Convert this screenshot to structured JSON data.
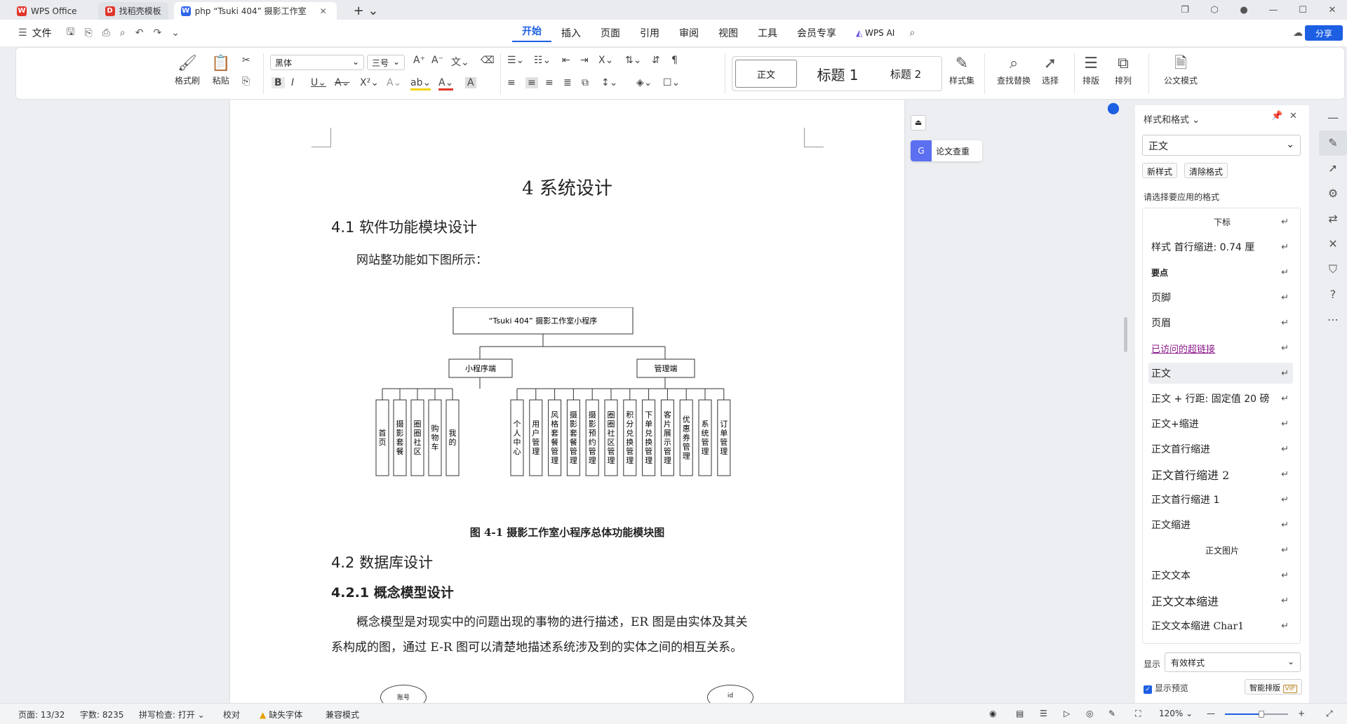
{
  "tabs": [
    {
      "label": "WPS Office"
    },
    {
      "label": "找稻壳模板"
    },
    {
      "label": "php “Tsuki 404” 摄影工作室"
    }
  ],
  "menu": {
    "file": "文件",
    "items": [
      "开始",
      "插入",
      "页面",
      "引用",
      "审阅",
      "视图",
      "工具",
      "会员专享"
    ],
    "active": "开始",
    "wps_ai": "WPS AI",
    "share": "分享"
  },
  "ribbon": {
    "format_painter": "格式刷",
    "paste": "粘贴",
    "font_name": "黑体",
    "font_size": "三号",
    "style_normal": "正文",
    "style_h1": "标题 1",
    "style_h2": "标题 2",
    "style_set": "样式集",
    "find_replace": "查找替换",
    "select": "选择",
    "layout": "排版",
    "arrange": "排列",
    "formula_mode": "公文模式"
  },
  "doc": {
    "h1": "4 系统设计",
    "h2_1": "4.1 软件功能模块设计",
    "p1": "网站整功能如下图所示：",
    "caption": "图 4-1 摄影工作室小程序总体功能模块图",
    "h2_2": "4.2 数据库设计",
    "h3_1": "4.2.1 概念模型设计",
    "p2_line1": "概念模型是对现实中的问题出现的事物的进行描述，ER 图是由实体及其关",
    "p2_line2": "系构成的图，通过 E-R 图可以清楚地描述系统涉及到的实体之间的相互关系。",
    "er_left": "账号",
    "er_right": "id"
  },
  "diagram": {
    "root": "“Tsuki 404” 摄影工作室小程序",
    "left_branch": "小程序端",
    "right_branch": "管理端",
    "left_leaves": [
      "首页",
      "摄影套餐",
      "圈圈社区",
      "购物车",
      "我的"
    ],
    "right_leaves": [
      "个人中心",
      "用户管理",
      "风格套餐管理",
      "摄影套餐管理",
      "摄影预约管理",
      "圈圈社区管理",
      "积分兑换管理",
      "下单兑换管理",
      "客片展示管理",
      "优惠券管理",
      "系统管理",
      "订单管理"
    ]
  },
  "float_btn": "论文查重",
  "panel": {
    "title": "样式和格式",
    "current": "正文",
    "new_style": "新样式",
    "clear_format": "清除格式",
    "prompt": "请选择要应用的格式",
    "styles": [
      "下标",
      "样式 首行缩进: 0.74 厘",
      "要点",
      "页脚",
      "页眉",
      "已访问的超链接",
      "正文",
      "正文 + 行距: 固定值 20 磅",
      "正文+缩进",
      "正文首行缩进",
      "正文首行缩进 2",
      "正文首行缩进 1",
      "正文缩进",
      "正文图片",
      "正文文本",
      "正文文本缩进",
      "正文文本缩进 Char1"
    ],
    "selected": "正文",
    "show_label": "显示",
    "show_value": "有效样式",
    "preview": "显示预览",
    "smart": "智能排版",
    "vip": "VIP"
  },
  "status": {
    "page": "页面: 13/32",
    "words": "字数: 8235",
    "spell": "拼写检查: 打开",
    "proof": "校对",
    "missing_font": "缺失字体",
    "compat": "兼容模式",
    "zoom": "120%"
  },
  "colors": {
    "accent": "#1d5fe3",
    "link": "#8b1a8b"
  }
}
